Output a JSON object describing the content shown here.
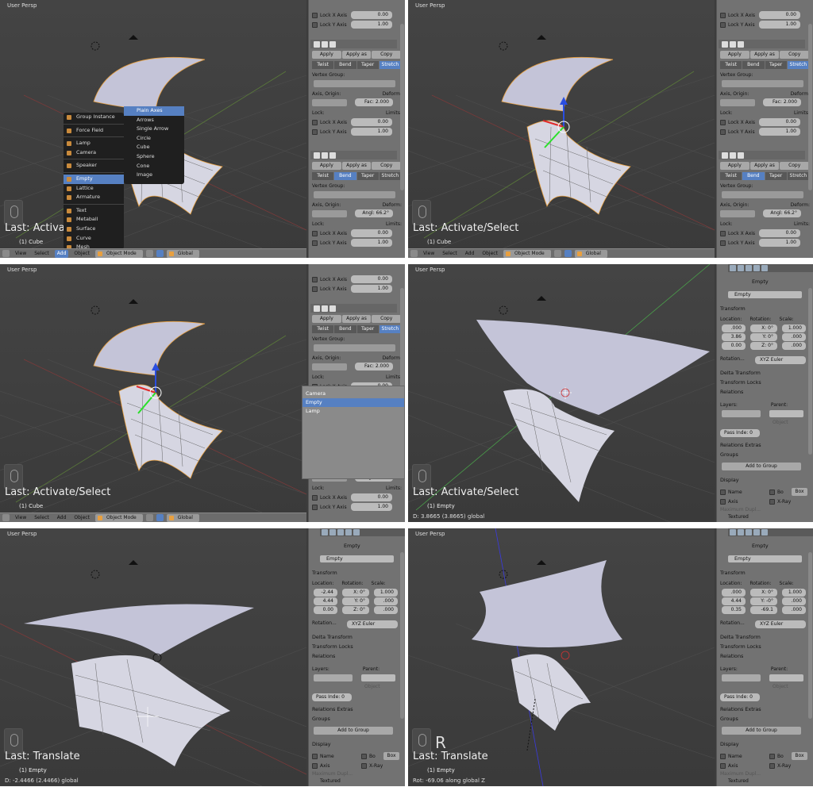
{
  "panels": [
    {
      "view_title": "User Persp",
      "last_op": "Last: Activate/Select",
      "object_line": "(1) Cube",
      "status_line": "",
      "header": {
        "view": "View",
        "select": "Select",
        "add": "Add",
        "object": "Object",
        "mode": "Object Mode",
        "orientation": "Global"
      },
      "add_menu": [
        "Group Instance",
        "Force Field",
        "Lamp",
        "Camera",
        "Speaker",
        "Empty",
        "Lattice",
        "Armature",
        "Text",
        "Metaball",
        "Surface",
        "Curve",
        "Mesh"
      ],
      "empty_submenu": [
        "Plain Axes",
        "Arrows",
        "Single Arrow",
        "Circle",
        "Cube",
        "Sphere",
        "Cone",
        "Image"
      ]
    },
    {
      "view_title": "User Persp",
      "last_op": "Last: Activate/Select",
      "object_line": "(1) Cube",
      "status_line": "",
      "header": {
        "view": "View",
        "select": "Select",
        "add": "Add",
        "object": "Object",
        "mode": "Object Mode",
        "orientation": "Global"
      }
    },
    {
      "view_title": "User Persp",
      "last_op": "Last: Activate/Select",
      "object_line": "(1) Cube",
      "status_line": "",
      "header": {
        "view": "View",
        "select": "Select",
        "add": "Add",
        "object": "Object",
        "mode": "Object Mode",
        "orientation": "Global"
      },
      "popup": [
        "Camera",
        "Empty",
        "Lamp"
      ]
    },
    {
      "view_title": "User Persp",
      "last_op": "Last: Activate/Select",
      "object_line": "(1) Empty",
      "status_line": "D: 3.8665 (3.8665) global"
    },
    {
      "view_title": "User Persp",
      "last_op": "Last: Translate",
      "object_line": "(1) Empty",
      "status_line": "D: -2.4466 (2.4466) global"
    },
    {
      "view_title": "User Persp",
      "last_op": "Last: Translate",
      "object_line": "(1) Empty",
      "status_line": "Rot: -69.06 along global Z",
      "key_overlay": "R"
    }
  ],
  "modifier": {
    "lock_x": "Lock X Axis",
    "lock_y": "Lock Y Axis",
    "val0": "0.00",
    "val1": "1.00",
    "apply": "Apply",
    "apply_as": "Apply as",
    "copy": "Copy",
    "tabs": [
      "Twist",
      "Bend",
      "Taper",
      "Stretch"
    ],
    "vertex_group": "Vertex Group:",
    "axis_origin": "Axis, Origin:",
    "deform": "Deform:",
    "lock": "Lock:",
    "limits": "Limits:",
    "fac": "Fac: 2.000",
    "angle": "Angl: 66.2°"
  },
  "object_props": {
    "name": "Empty",
    "transform": "Transform",
    "location": "Location:",
    "rotation": "Rotation:",
    "scale": "Scale:",
    "rotation_mode_label": "Rotation...",
    "rotation_mode": "XYZ Euler",
    "delta": "Delta Transform",
    "locks": "Transform Locks",
    "relations": "Relations",
    "layers": "Layers:",
    "parent": "Parent:",
    "parent_type": "Object",
    "pass_index": "Pass Inde: 0",
    "relations_extras": "Relations Extras",
    "groups": "Groups",
    "add_to_group": "Add to Group",
    "display": "Display",
    "name_label": "Name",
    "bounds": "Bo",
    "box": "Box",
    "axis": "Axis",
    "xray": "X-Ray",
    "max_dupli": "Maximum Dupl...",
    "textured": "Textured",
    "panel3": {
      "loc": [
        ".000",
        "3.86",
        "0.00"
      ],
      "rot": [
        "X: 0°",
        "Y: 0°",
        "Z: 0°"
      ],
      "scale": [
        "1.000",
        ".000",
        ".000"
      ]
    },
    "panel4": {
      "loc": [
        "-2.44",
        "4.44",
        "0.00"
      ],
      "rot": [
        "X: 0°",
        "Y: 0°",
        "Z: 0°"
      ],
      "scale": [
        "1.000",
        ".000",
        ".000"
      ]
    },
    "panel5": {
      "loc": [
        ".000",
        "4.44",
        "0.35"
      ],
      "rot": [
        "X: 0°",
        "Y: -0°",
        "-69.1"
      ],
      "scale": [
        "1.000",
        ".000",
        ".000"
      ]
    }
  },
  "colors": {
    "accent": "#5680c2",
    "viewport": "#3c3c3c",
    "props_bg": "#727272",
    "menu_bg": "#1f1f1f"
  }
}
